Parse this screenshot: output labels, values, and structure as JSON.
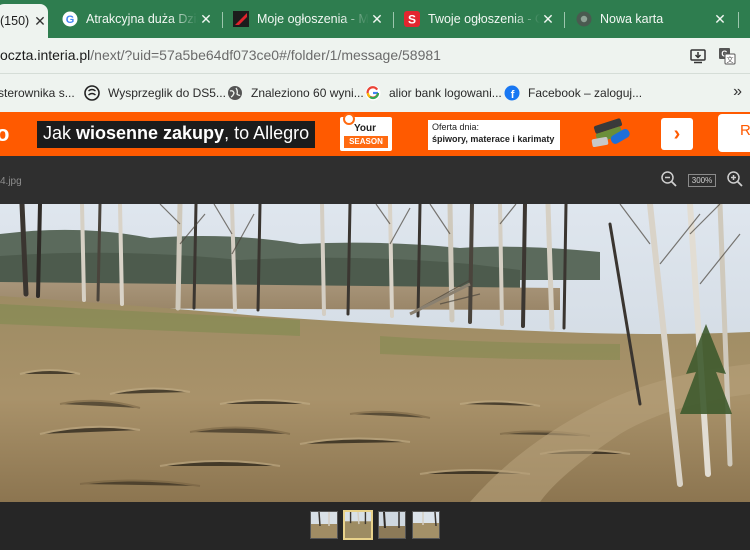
{
  "tabs": [
    {
      "label": "(150)",
      "active": true
    },
    {
      "label": "Atrakcyjna duża Dział",
      "favicon": "google-icon"
    },
    {
      "label": "Moje ogłoszenia - Mi",
      "favicon": "marketplace-icon"
    },
    {
      "label": "Twoje ogłoszenia - O",
      "favicon": "s-brand-icon"
    },
    {
      "label": "Nowa karta",
      "favicon": "chrome-icon"
    }
  ],
  "tab_close_glyph": "✕",
  "address_bar": {
    "host": "oczta.interia.pl",
    "path": "/next/?uid=57a5be64df073ce0#/folder/1/message/58981"
  },
  "bookmarks": [
    {
      "label": "sterownika s...",
      "icon": "none"
    },
    {
      "label": "Wysprzeglik do DS5...",
      "icon": "citroen-ds-icon"
    },
    {
      "label": "Znaleziono 60 wyni...",
      "icon": "globe-icon"
    },
    {
      "label": "alior bank logowani...",
      "icon": "google-icon"
    },
    {
      "label": "Facebook – zaloguj...",
      "icon": "facebook-icon"
    }
  ],
  "bookmarks_more": "»",
  "ad": {
    "logo_fragment": "o",
    "headline_pre": "Jak ",
    "headline_bold": "wiosenne zakupy",
    "headline_post": ", to Allegro",
    "season_line1": "Your",
    "season_line2": "SEASON",
    "offer_line1": "Oferta dnia:",
    "offer_line2": "śpiwory, materace i karimaty",
    "arrow": "›",
    "cta_fragment": "R"
  },
  "viewer": {
    "filename": "4.jpg",
    "zoom_level": "300%",
    "thumbnails": 4,
    "selected_thumbnail": 2
  },
  "colors": {
    "tabstrip": "#2e7d4f",
    "toolbar": "#eef3ef",
    "ad_orange": "#ff5a00",
    "viewer_bg": "#262626"
  }
}
